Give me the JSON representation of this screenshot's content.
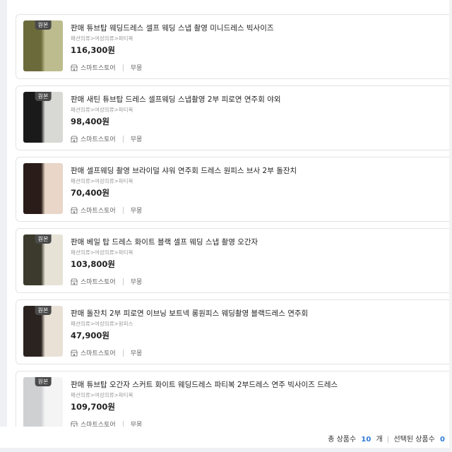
{
  "products": [
    {
      "title": "판매 튜브탑 웨딩드레스 셀프 웨딩 스냅 촬영 미니드레스 빅사이즈",
      "category": "패션의류>여성의류>파티복",
      "price": "116,300원",
      "badge": "원본",
      "store": "스마트스토어",
      "shipping": "무몽",
      "colors": [
        "#6b6a3a",
        "#bcbc8e"
      ]
    },
    {
      "title": "판매 새틴 튜브탑 드레스 셀프웨딩 스냅촬영 2부 피로연 연주회 야외",
      "category": "패션의류>여성의류>파티복",
      "price": "98,400원",
      "badge": "원본",
      "store": "스마트스토어",
      "shipping": "무몽",
      "colors": [
        "#1a1a1a",
        "#d8d8d4"
      ]
    },
    {
      "title": "판매 셀프웨딩 촬영 브라이덜 샤워 연주회 드레스 원피스 브사 2부 돌잔치",
      "category": "패션의류>여성의류>파티복",
      "price": "70,400원",
      "badge": "",
      "store": "스마트스토어",
      "shipping": "무몽",
      "colors": [
        "#2a1c18",
        "#e9d6c8"
      ]
    },
    {
      "title": "판매 베일 탑 드레스 화이트 블랙 셀프 웨딩 스냅 촬영 오간자",
      "category": "패션의류>여성의류>파티복",
      "price": "103,800원",
      "badge": "원본",
      "store": "스마트스토어",
      "shipping": "무몽",
      "colors": [
        "#3b3a2c",
        "#e6e2d6"
      ]
    },
    {
      "title": "판매 돌잔치 2부 피로연 이브닝 보트넥 롱원피스 웨딩촬영 블랙드레스 연주회",
      "category": "패션의류>여성의류>원피스",
      "price": "47,900원",
      "badge": "원본",
      "store": "스마트스토어",
      "shipping": "무몽",
      "colors": [
        "#2b231f",
        "#e9e1d6"
      ]
    },
    {
      "title": "판매 튜브탑 오간자 스커트 화이트 웨딩드레스 파티복 2부드레스 연주 빅사이즈 드레스",
      "category": "패션의류>여성의류>파티복",
      "price": "109,700원",
      "badge": "원본",
      "store": "스마트스토어",
      "shipping": "무몽",
      "colors": [
        "#cfd0d2",
        "#f4f4f4"
      ]
    }
  ],
  "footer": {
    "total_label": "총 상품수",
    "total_count": "10",
    "unit": "개",
    "selected_label": "선택된 상품수",
    "selected_count": "0"
  }
}
